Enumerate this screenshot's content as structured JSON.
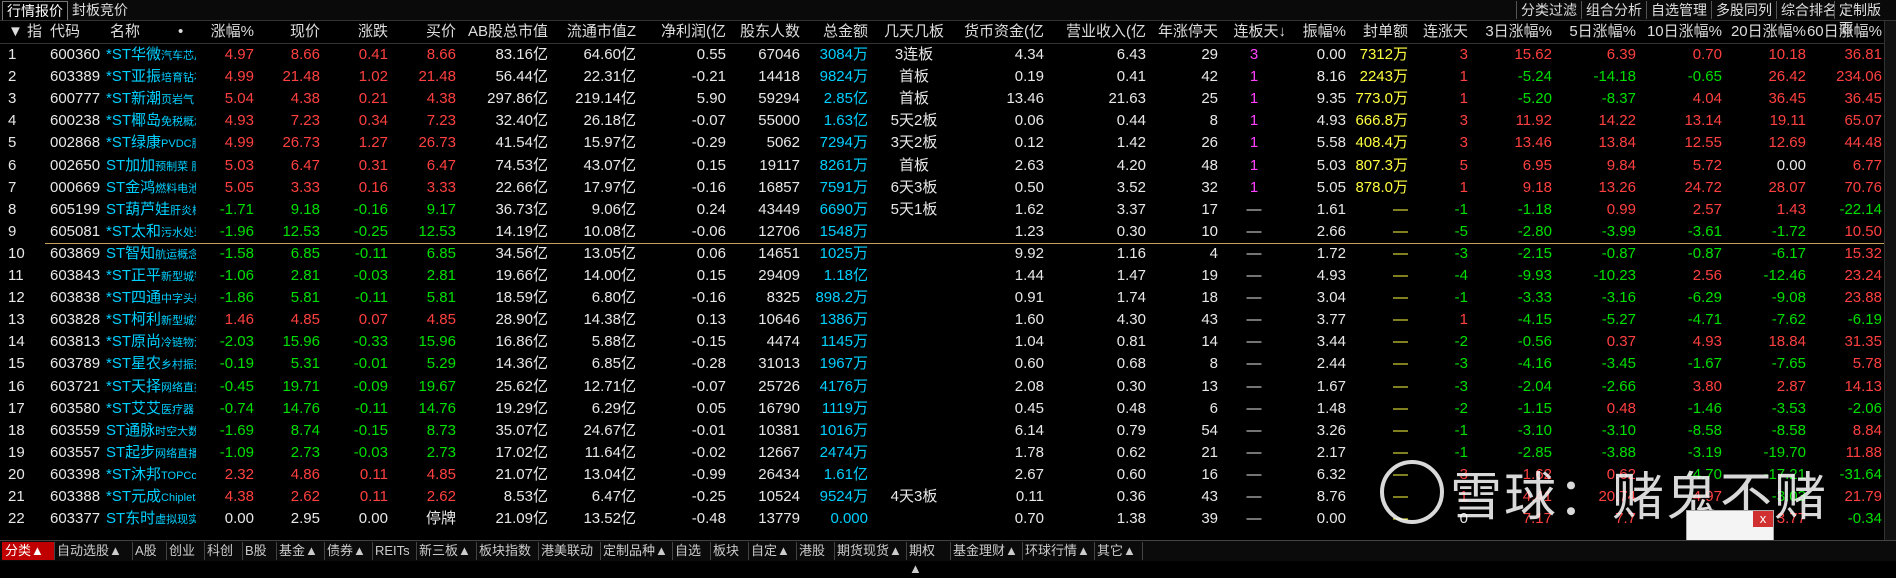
{
  "top_tabs": [
    "行情报价",
    "封板竞价"
  ],
  "right_tabs": [
    "分类过滤",
    "组合分析",
    "自选管理",
    "多股同列",
    "综合排名",
    "定制版面"
  ],
  "columns": {
    "idx": "▼ 指",
    "code": "代码",
    "name": "名称",
    "dot": "•",
    "pct": "涨幅%",
    "price": "现价",
    "chg": "涨跌",
    "buy": "买价",
    "ab_cap": "AB股总市值",
    "float_cap": "流通市值Z",
    "profit": "净利润(亿",
    "holders": "股东人数",
    "amount": "总金额",
    "boards": "几天几板",
    "cash": "货币资金(亿",
    "revenue": "营业收入(亿",
    "limit_days": "年涨停天",
    "cont_days": "连板天↓",
    "amp": "振幅%",
    "seal_amt": "封单额",
    "up_days": "连涨天",
    "p3": "3日涨幅%",
    "p5": "5日涨幅%",
    "p10": "10日涨幅%",
    "p20": "20日涨幅%",
    "p60": "60日涨幅%"
  },
  "rows": [
    {
      "i": "1",
      "code": "600360",
      "name": "*ST华微",
      "tag": "汽车芯片",
      "pct": "4.97",
      "price": "8.66",
      "chg": "0.41",
      "buy": "8.66",
      "ab": "83.16亿",
      "fl": "64.60亿",
      "profit": "0.55",
      "holders": "67046",
      "amt": "3084万",
      "boards": "3连板",
      "cash": "4.34",
      "rev": "6.43",
      "ld": "29",
      "cd": "3",
      "amp": "0.00",
      "seal": "7312万",
      "ud": "3",
      "p3": "15.62",
      "p5": "6.39",
      "p10": "0.70",
      "p20": "10.18",
      "p60": "36.81"
    },
    {
      "i": "2",
      "code": "603389",
      "name": "*ST亚振",
      "tag": "培育钻石",
      "pct": "4.99",
      "price": "21.48",
      "chg": "1.02",
      "buy": "21.48",
      "ab": "56.44亿",
      "fl": "22.31亿",
      "profit": "-0.21",
      "holders": "14418",
      "amt": "9824万",
      "boards": "首板",
      "cash": "0.19",
      "rev": "0.41",
      "ld": "42",
      "cd": "1",
      "amp": "8.16",
      "seal": "2243万",
      "ud": "1",
      "p3": "-5.24",
      "p5": "-14.18",
      "p10": "-0.65",
      "p20": "26.42",
      "p60": "234.06"
    },
    {
      "i": "3",
      "code": "600777",
      "name": "*ST新潮",
      "tag": "页岩气 赛",
      "pct": "5.04",
      "price": "4.38",
      "chg": "0.21",
      "buy": "4.38",
      "ab": "297.86亿",
      "fl": "219.14亿",
      "profit": "5.90",
      "holders": "59294",
      "amt": "2.85亿",
      "boards": "首板",
      "cash": "13.46",
      "rev": "21.63",
      "ld": "25",
      "cd": "1",
      "amp": "9.35",
      "seal": "773.0万",
      "ud": "1",
      "p3": "-5.20",
      "p5": "-8.37",
      "p10": "4.04",
      "p20": "36.45",
      "p60": "36.45"
    },
    {
      "i": "4",
      "code": "600238",
      "name": "*ST椰岛",
      "tag": "免税概念",
      "pct": "4.93",
      "price": "7.23",
      "chg": "0.34",
      "buy": "7.23",
      "ab": "32.40亿",
      "fl": "26.18亿",
      "profit": "-0.07",
      "holders": "55000",
      "amt": "1.63亿",
      "boards": "5天2板",
      "cash": "0.06",
      "rev": "0.44",
      "ld": "8",
      "cd": "1",
      "amp": "4.93",
      "seal": "666.8万",
      "ud": "3",
      "p3": "11.92",
      "p5": "14.22",
      "p10": "13.14",
      "p20": "19.11",
      "p60": "65.07"
    },
    {
      "i": "5",
      "code": "002868",
      "name": "*ST绿康",
      "tag": "PVDC膜",
      "pct": "4.99",
      "price": "26.73",
      "chg": "1.27",
      "buy": "26.73",
      "ab": "41.54亿",
      "fl": "15.97亿",
      "profit": "-0.29",
      "holders": "5062",
      "amt": "7294万",
      "boards": "3天2板",
      "cash": "0.12",
      "rev": "1.42",
      "ld": "26",
      "cd": "1",
      "amp": "5.58",
      "seal": "408.4万",
      "ud": "3",
      "p3": "13.46",
      "p5": "13.84",
      "p10": "12.55",
      "p20": "12.69",
      "p60": "44.48"
    },
    {
      "i": "6",
      "code": "002650",
      "name": "ST加加",
      "tag": "预制菜 股",
      "pct": "5.03",
      "price": "6.47",
      "chg": "0.31",
      "buy": "6.47",
      "ab": "74.53亿",
      "fl": "43.07亿",
      "profit": "0.15",
      "holders": "19117",
      "amt": "8261万",
      "boards": "首板",
      "cash": "2.63",
      "rev": "4.20",
      "ld": "48",
      "cd": "1",
      "amp": "5.03",
      "seal": "807.3万",
      "ud": "5",
      "p3": "6.95",
      "p5": "9.84",
      "p10": "5.72",
      "p20": "0.00",
      "p60": "6.77"
    },
    {
      "i": "7",
      "code": "000669",
      "name": "ST金鸿",
      "tag": "燃料电池",
      "pct": "5.05",
      "price": "3.33",
      "chg": "0.16",
      "buy": "3.33",
      "ab": "22.66亿",
      "fl": "17.97亿",
      "profit": "-0.16",
      "holders": "16857",
      "amt": "7591万",
      "boards": "6天3板",
      "cash": "0.50",
      "rev": "3.52",
      "ld": "32",
      "cd": "1",
      "amp": "5.05",
      "seal": "878.0万",
      "ud": "1",
      "p3": "9.18",
      "p5": "13.26",
      "p10": "24.72",
      "p20": "28.07",
      "p60": "70.76"
    },
    {
      "i": "8",
      "code": "605199",
      "name": "ST葫芦娃",
      "tag": "肝炎概念",
      "pct": "-1.71",
      "price": "9.18",
      "chg": "-0.16",
      "buy": "9.17",
      "ab": "36.73亿",
      "fl": "9.06亿",
      "profit": "0.24",
      "holders": "43449",
      "amt": "6690万",
      "boards": "5天1板",
      "cash": "1.62",
      "rev": "3.37",
      "ld": "17",
      "cd": "—",
      "amp": "1.61",
      "seal": "—",
      "ud": "-1",
      "p3": "-1.18",
      "p5": "0.99",
      "p10": "2.57",
      "p20": "1.43",
      "p60": "-22.14"
    },
    {
      "i": "9",
      "code": "605081",
      "name": "*ST太和",
      "tag": "污水处理",
      "pct": "-1.96",
      "price": "12.53",
      "chg": "-0.25",
      "buy": "12.53",
      "ab": "14.19亿",
      "fl": "10.08亿",
      "profit": "-0.06",
      "holders": "12706",
      "amt": "1548万",
      "boards": "",
      "cash": "1.23",
      "rev": "0.30",
      "ld": "10",
      "cd": "—",
      "amp": "2.66",
      "seal": "—",
      "ud": "-5",
      "p3": "-2.80",
      "p5": "-3.99",
      "p10": "-3.61",
      "p20": "-1.72",
      "p60": "10.50"
    },
    {
      "i": "10",
      "code": "603869",
      "name": "ST智知",
      "tag": "航运概念",
      "pct": "-1.58",
      "price": "6.85",
      "chg": "-0.11",
      "buy": "6.85",
      "ab": "34.56亿",
      "fl": "13.05亿",
      "profit": "0.06",
      "holders": "14651",
      "amt": "1025万",
      "boards": "",
      "cash": "9.92",
      "rev": "1.16",
      "ld": "4",
      "cd": "—",
      "amp": "1.72",
      "seal": "—",
      "ud": "-3",
      "p3": "-2.15",
      "p5": "-0.87",
      "p10": "-0.87",
      "p20": "-6.17",
      "p60": "15.32"
    },
    {
      "i": "11",
      "code": "603843",
      "name": "*ST正平",
      "tag": "新型城镇",
      "pct": "-1.06",
      "price": "2.81",
      "chg": "-0.03",
      "buy": "2.81",
      "ab": "19.66亿",
      "fl": "14.00亿",
      "profit": "0.15",
      "holders": "29409",
      "amt": "1.18亿",
      "boards": "",
      "cash": "1.44",
      "rev": "1.47",
      "ld": "19",
      "cd": "—",
      "amp": "4.93",
      "seal": "—",
      "ud": "-4",
      "p3": "-9.93",
      "p5": "-10.23",
      "p10": "2.56",
      "p20": "-12.46",
      "p60": "23.24"
    },
    {
      "i": "12",
      "code": "603838",
      "name": "*ST四通",
      "tag": "中字头概",
      "pct": "-1.86",
      "price": "5.81",
      "chg": "-0.11",
      "buy": "5.81",
      "ab": "18.59亿",
      "fl": "6.80亿",
      "profit": "-0.16",
      "holders": "8325",
      "amt": "898.2万",
      "boards": "",
      "cash": "0.91",
      "rev": "1.74",
      "ld": "18",
      "cd": "—",
      "amp": "3.04",
      "seal": "—",
      "ud": "-1",
      "p3": "-3.33",
      "p5": "-3.16",
      "p10": "-6.29",
      "p20": "-9.08",
      "p60": "23.88"
    },
    {
      "i": "13",
      "code": "603828",
      "name": "*ST柯利",
      "tag": "新型城镇",
      "pct": "1.46",
      "price": "4.85",
      "chg": "0.07",
      "buy": "4.85",
      "ab": "28.90亿",
      "fl": "14.38亿",
      "profit": "0.13",
      "holders": "10646",
      "amt": "1386万",
      "boards": "",
      "cash": "1.60",
      "rev": "4.30",
      "ld": "43",
      "cd": "—",
      "amp": "3.77",
      "seal": "—",
      "ud": "1",
      "p3": "-4.15",
      "p5": "-5.27",
      "p10": "-4.71",
      "p20": "-7.62",
      "p60": "-6.19"
    },
    {
      "i": "14",
      "code": "603813",
      "name": "*ST原尚",
      "tag": "冷链物流",
      "pct": "-2.03",
      "price": "15.96",
      "chg": "-0.33",
      "buy": "15.96",
      "ab": "16.86亿",
      "fl": "5.88亿",
      "profit": "-0.15",
      "holders": "4474",
      "amt": "1145万",
      "boards": "",
      "cash": "1.04",
      "rev": "0.81",
      "ld": "14",
      "cd": "—",
      "amp": "3.44",
      "seal": "—",
      "ud": "-2",
      "p3": "-0.56",
      "p5": "0.37",
      "p10": "4.93",
      "p20": "18.84",
      "p60": "31.35"
    },
    {
      "i": "15",
      "code": "603789",
      "name": "*ST星农",
      "tag": "乡村振兴",
      "pct": "-0.19",
      "price": "5.31",
      "chg": "-0.01",
      "buy": "5.29",
      "ab": "14.36亿",
      "fl": "6.85亿",
      "profit": "-0.28",
      "holders": "31013",
      "amt": "1967万",
      "boards": "",
      "cash": "0.60",
      "rev": "0.68",
      "ld": "8",
      "cd": "—",
      "amp": "2.44",
      "seal": "—",
      "ud": "-3",
      "p3": "-4.16",
      "p5": "-3.45",
      "p10": "-1.67",
      "p20": "-7.65",
      "p60": "5.78"
    },
    {
      "i": "16",
      "code": "603721",
      "name": "*ST天择",
      "tag": "网络直播",
      "pct": "-0.45",
      "price": "19.71",
      "chg": "-0.09",
      "buy": "19.67",
      "ab": "25.62亿",
      "fl": "12.71亿",
      "profit": "-0.07",
      "holders": "25726",
      "amt": "4176万",
      "boards": "",
      "cash": "2.08",
      "rev": "0.30",
      "ld": "13",
      "cd": "—",
      "amp": "1.67",
      "seal": "—",
      "ud": "-3",
      "p3": "-2.04",
      "p5": "-2.66",
      "p10": "3.80",
      "p20": "2.87",
      "p60": "14.13"
    },
    {
      "i": "17",
      "code": "603580",
      "name": "*ST艾艾",
      "tag": "医疗器 转",
      "pct": "-0.74",
      "price": "14.76",
      "chg": "-0.11",
      "buy": "14.76",
      "ab": "19.29亿",
      "fl": "6.29亿",
      "profit": "0.05",
      "holders": "16790",
      "amt": "1119万",
      "boards": "",
      "cash": "0.45",
      "rev": "0.48",
      "ld": "6",
      "cd": "—",
      "amp": "1.48",
      "seal": "—",
      "ud": "-2",
      "p3": "-1.15",
      "p5": "0.48",
      "p10": "-1.46",
      "p20": "-3.53",
      "p60": "-2.06"
    },
    {
      "i": "18",
      "code": "603559",
      "name": "ST通脉",
      "tag": "时空大数据",
      "pct": "-1.69",
      "price": "8.74",
      "chg": "-0.15",
      "buy": "8.73",
      "ab": "35.07亿",
      "fl": "24.67亿",
      "profit": "-0.01",
      "holders": "10381",
      "amt": "1016万",
      "boards": "",
      "cash": "6.14",
      "rev": "0.79",
      "ld": "54",
      "cd": "—",
      "amp": "3.26",
      "seal": "—",
      "ud": "-1",
      "p3": "-3.10",
      "p5": "-3.10",
      "p10": "-8.58",
      "p20": "-8.58",
      "p60": "8.84"
    },
    {
      "i": "19",
      "code": "603557",
      "name": "ST起步",
      "tag": "网络直播",
      "pct": "-1.09",
      "price": "2.73",
      "chg": "-0.03",
      "buy": "2.73",
      "ab": "17.02亿",
      "fl": "11.64亿",
      "profit": "-0.02",
      "holders": "12667",
      "amt": "2474万",
      "boards": "",
      "cash": "1.78",
      "rev": "0.62",
      "ld": "21",
      "cd": "—",
      "amp": "2.17",
      "seal": "—",
      "ud": "-1",
      "p3": "-2.85",
      "p5": "-3.88",
      "p10": "-3.19",
      "p20": "-19.70",
      "p60": "11.88"
    },
    {
      "i": "20",
      "code": "603398",
      "name": "*ST沐邦",
      "tag": "TOPCon电池",
      "pct": "2.32",
      "price": "4.86",
      "chg": "0.11",
      "buy": "4.85",
      "ab": "21.07亿",
      "fl": "13.04亿",
      "profit": "-0.99",
      "holders": "26434",
      "amt": "1.61亿",
      "boards": "",
      "cash": "2.67",
      "rev": "0.60",
      "ld": "16",
      "cd": "—",
      "amp": "6.32",
      "seal": "—",
      "ud": "3",
      "p3": "1.62",
      "p5": "0.62",
      "p10": "-4.70",
      "p20": "-17.21",
      "p60": "-31.64"
    },
    {
      "i": "21",
      "code": "603388",
      "name": "*ST元成",
      "tag": "Chiplet概念",
      "pct": "4.38",
      "price": "2.62",
      "chg": "0.11",
      "buy": "2.62",
      "ab": "8.53亿",
      "fl": "6.47亿",
      "profit": "-0.25",
      "holders": "10524",
      "amt": "9524万",
      "boards": "4天3板",
      "cash": "0.11",
      "rev": "0.36",
      "ld": "43",
      "cd": "—",
      "amp": "8.76",
      "seal": "—",
      "ud": "1",
      "p3": "4.41",
      "p5": "20.74",
      "p10": "4.97",
      "p20": "-3.03",
      "p60": "21.79"
    },
    {
      "i": "22",
      "code": "603377",
      "name": "ST东时",
      "tag": "虚拟现实",
      "pct": "0.00",
      "price": "2.95",
      "chg": "0.00",
      "buy": "停牌",
      "ab": "21.09亿",
      "fl": "13.52亿",
      "profit": "-0.48",
      "holders": "13779",
      "amt": "0.000",
      "boards": "",
      "cash": "0.70",
      "rev": "1.38",
      "ld": "39",
      "cd": "—",
      "amp": "0.00",
      "seal": "—",
      "ud": "0",
      "p3": "7.17",
      "p5": "7.7",
      "p10": "7.7",
      "p20": "3.77",
      "p60": "-0.34"
    }
  ],
  "bottom_tabs": [
    "分类▲",
    "自动选股▲",
    "A股",
    "创业",
    "科创",
    "B股",
    "基金▲",
    "债券▲",
    "REITs",
    "新三板▲",
    "板块指数",
    "港美联动",
    "定制品种▲",
    "自选",
    "板块",
    "自定▲",
    "港股",
    "期货现货▲",
    "期权▲",
    "基金理财▲",
    "环球行情▲",
    "其它▲"
  ],
  "watermark": "雪球：赌鬼不赌",
  "popup_close": "x",
  "colors": {
    "up": "#ff4040",
    "down": "#00e000",
    "name": "#00d0ff",
    "flat": "#e8e8e8",
    "yellow": "#ffff40",
    "magenta": "#ff40ff"
  }
}
